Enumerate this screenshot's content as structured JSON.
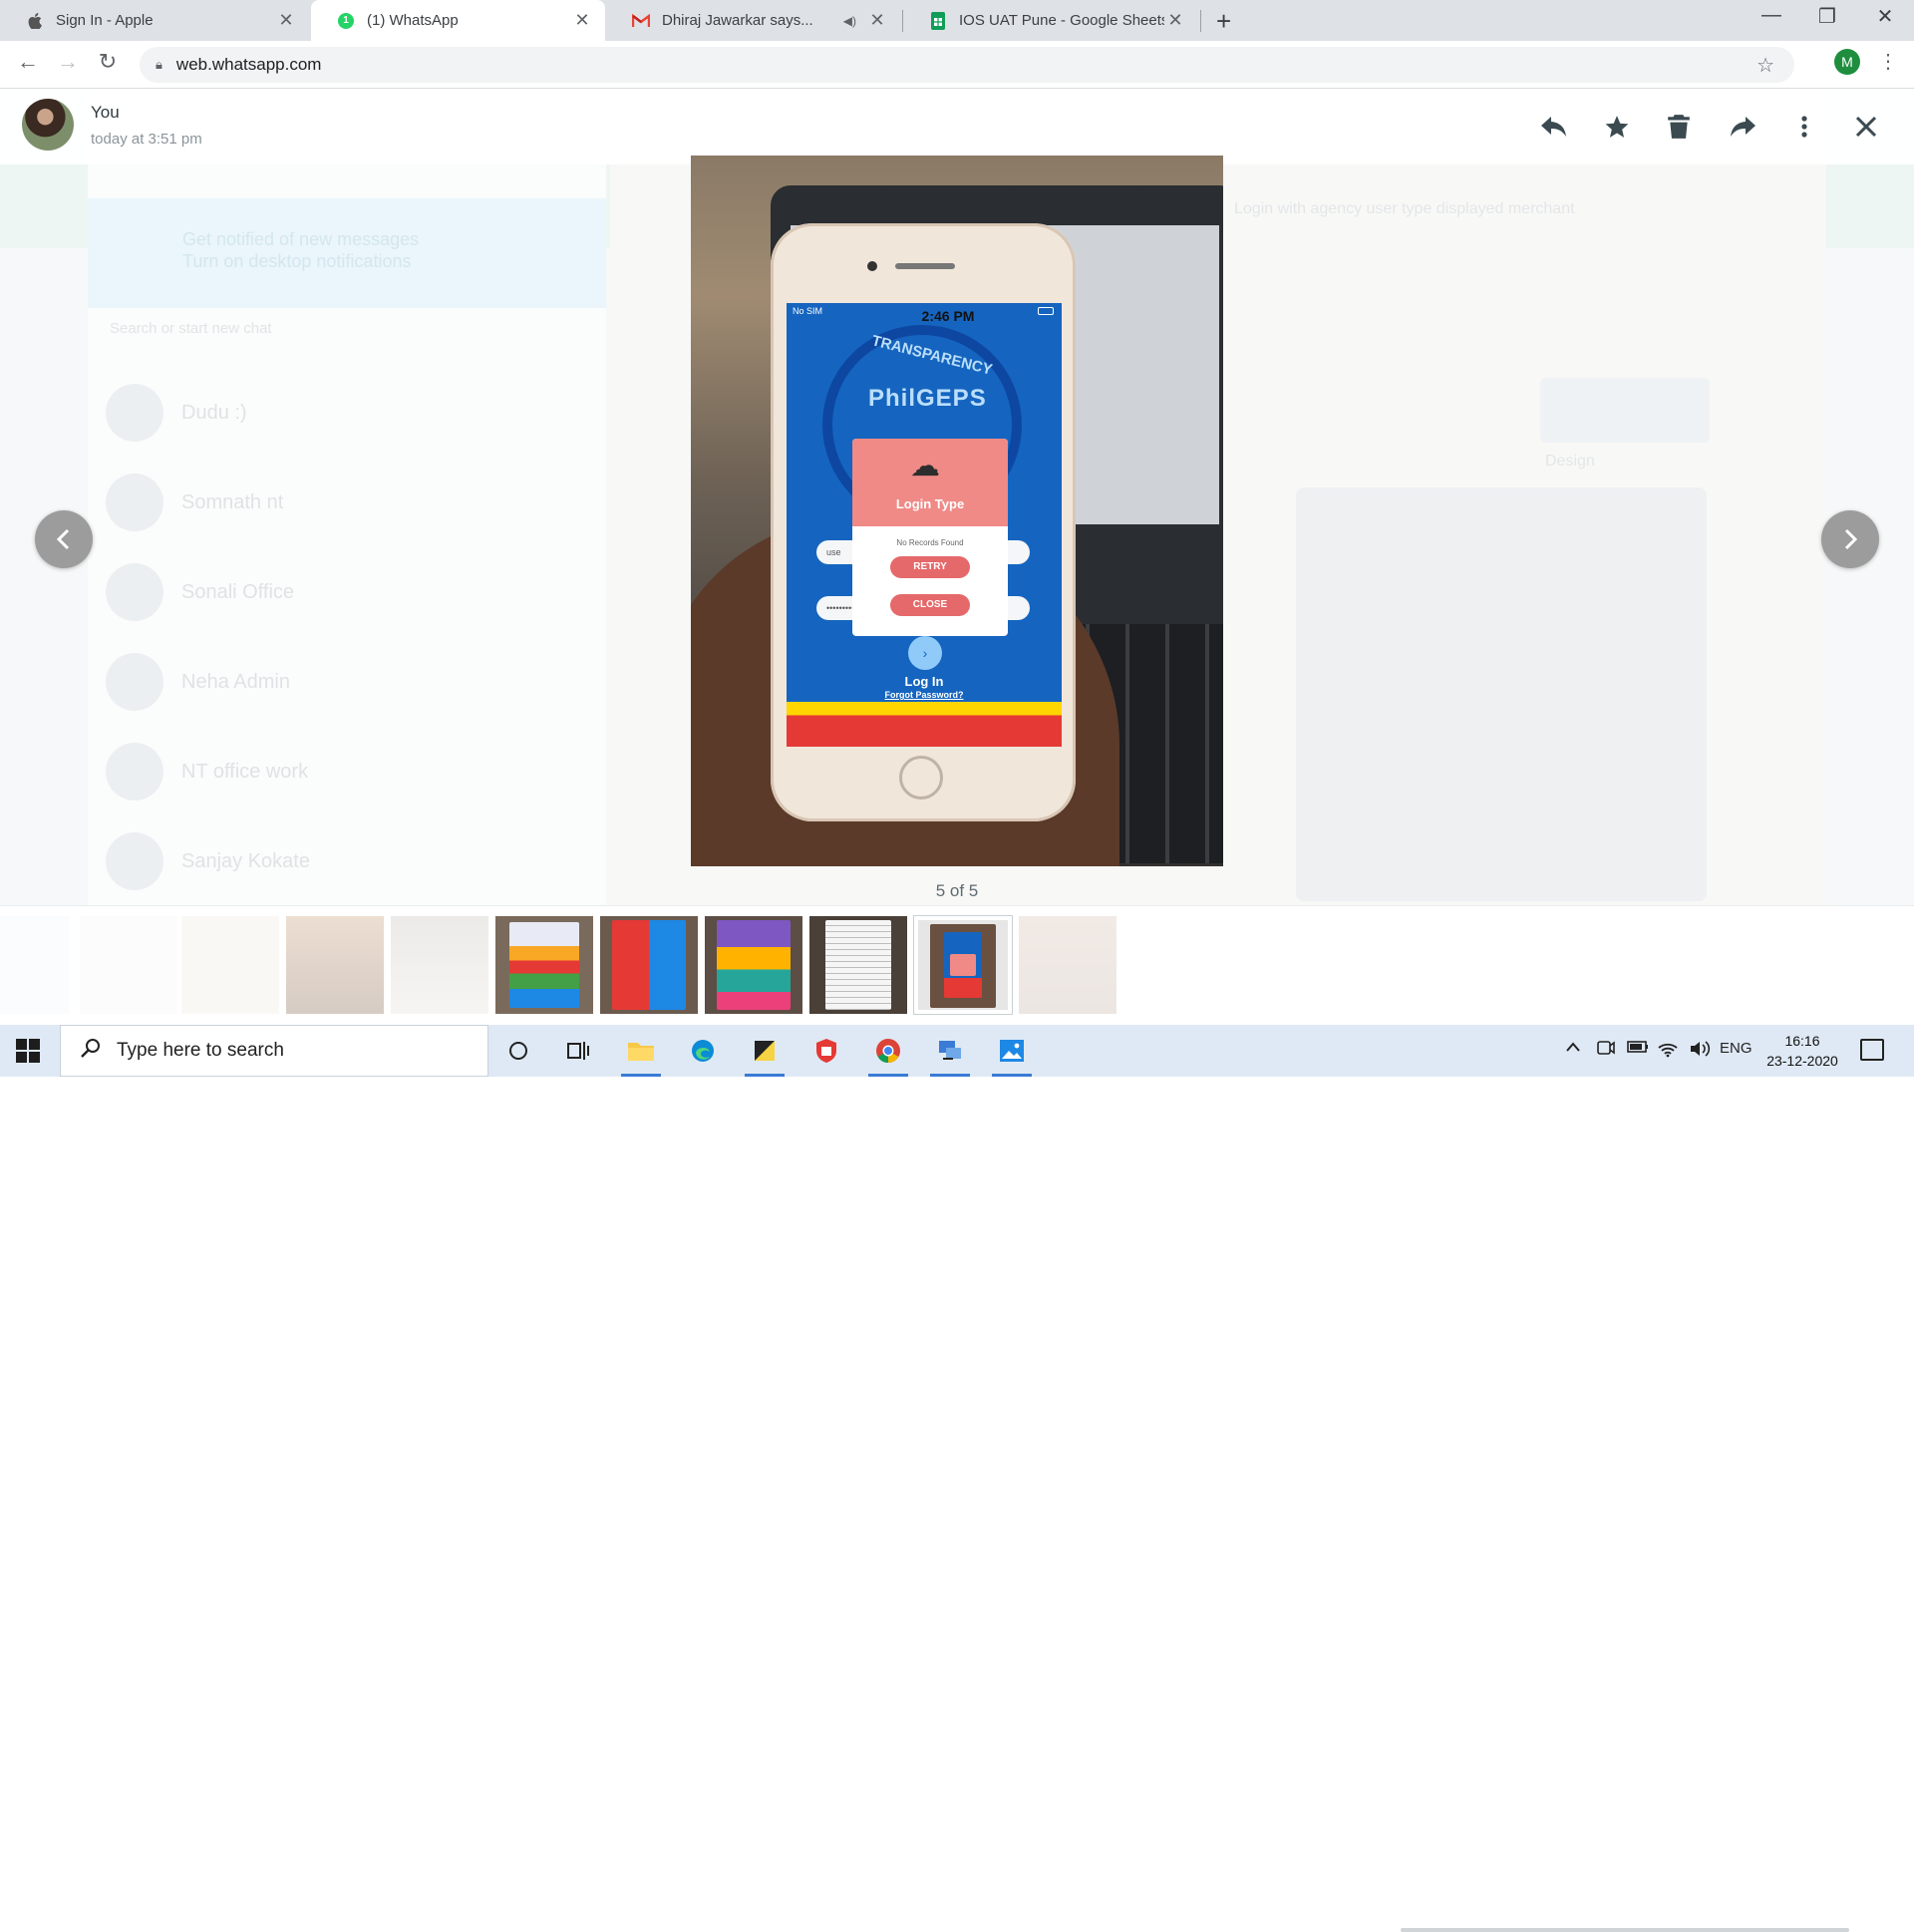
{
  "browser": {
    "tabs": [
      {
        "title": "Sign In - Apple",
        "favicon": "apple-icon",
        "active": false
      },
      {
        "title": "(1) WhatsApp",
        "favicon": "whatsapp-icon",
        "badge": "1",
        "active": true
      },
      {
        "title": "Dhiraj Jawarkar says...",
        "favicon": "gmail-icon",
        "muted": true,
        "active": false
      },
      {
        "title": "IOS UAT Pune - Google Sheets",
        "favicon": "sheets-icon",
        "active": false
      }
    ],
    "url": "web.whatsapp.com",
    "profile_initial": "M"
  },
  "viewer": {
    "sender": "You",
    "timestamp": "today at 3:51 pm",
    "counter": "5 of 5",
    "actions": [
      "reply-icon",
      "star-icon",
      "delete-icon",
      "forward-icon",
      "menu-icon",
      "close-icon"
    ]
  },
  "photo": {
    "status_carrier": "No SIM",
    "status_time": "2:46 PM",
    "app_brand": "PhilGEPS",
    "arc_text": "TRANSPARENCY",
    "dialog_title": "Login Type",
    "dialog_message": "No Records Found",
    "retry_label": "RETRY",
    "close_label": "CLOSE",
    "username_placeholder": "use",
    "password_mask": "•••••••••",
    "login_label": "Log In",
    "forgot_label": "Forgot Password?"
  },
  "background": {
    "notification_text": "Get notified of new messages",
    "notification_sub": "Turn on desktop notifications",
    "search_placeholder": "Search or start new chat",
    "chats": [
      "Dudu :)",
      "Somnath nt",
      "Sonali Office",
      "Neha Admin",
      "NT office work",
      "Sanjay Kokate"
    ],
    "conversation_line": "Login with agency user type displayed merchant",
    "design_label": "Design"
  },
  "taskbar": {
    "search_placeholder": "Type here to search",
    "language": "ENG",
    "time": "16:16",
    "date": "23-12-2020"
  },
  "colors": {
    "dialog_header": "#ef8a86",
    "dialog_button": "#e5696a",
    "app_blue": "#1565c0",
    "nav_arrow": "#9c9c9c"
  }
}
